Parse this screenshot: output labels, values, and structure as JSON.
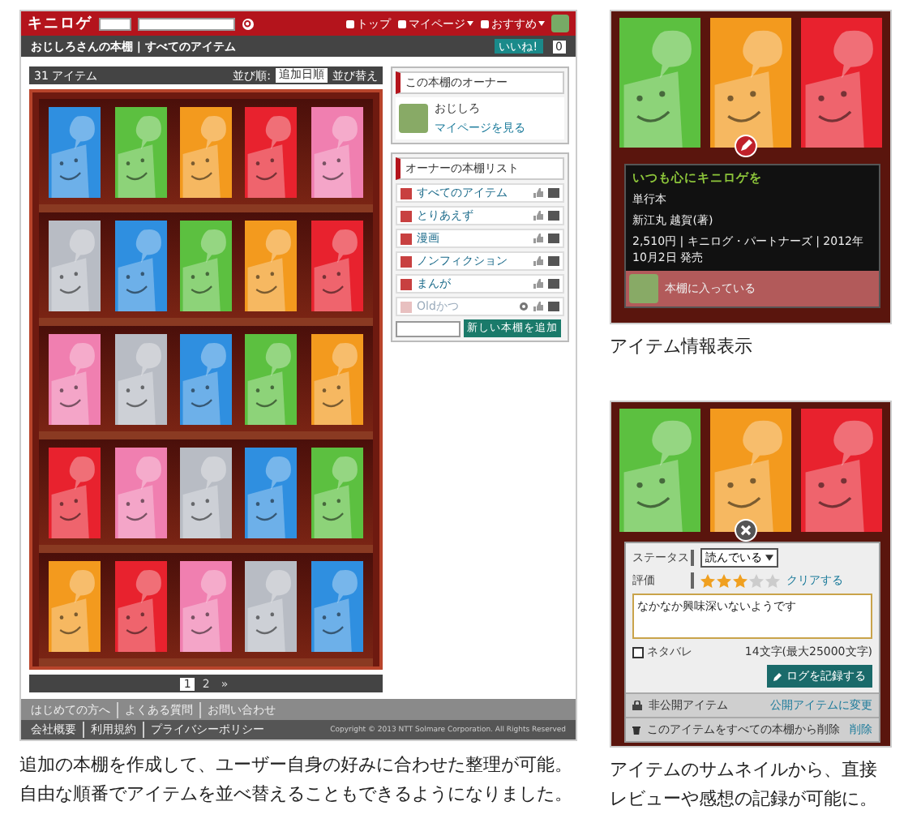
{
  "site": {
    "logo": "キニロゲ",
    "nav": [
      {
        "label": "トップ",
        "menu": false
      },
      {
        "label": "マイページ",
        "menu": true
      },
      {
        "label": "おすすめ",
        "menu": true
      }
    ]
  },
  "breadcrumb": {
    "text": "おじしろさんの本棚 | すべてのアイテム",
    "like": "いいね!",
    "like_count": "0"
  },
  "toolbar": {
    "count": "31 アイテム",
    "sort_label": "並び順:",
    "sort_value": "追加日順",
    "sort_button": "並び替え"
  },
  "shelves": [
    {
      "books": [
        {
          "color": "#2f8fe0"
        },
        {
          "color": "#5cc040"
        },
        {
          "color": "#f39a1e"
        },
        {
          "color": "#e8222e"
        },
        {
          "color": "#f07fb0"
        }
      ]
    },
    {
      "books": [
        {
          "color": "#b8bcc4"
        },
        {
          "color": "#2f8fe0"
        },
        {
          "color": "#5cc040"
        },
        {
          "color": "#f39a1e"
        },
        {
          "color": "#e8222e"
        }
      ]
    },
    {
      "books": [
        {
          "color": "#f07fb0"
        },
        {
          "color": "#b8bcc4"
        },
        {
          "color": "#2f8fe0"
        },
        {
          "color": "#5cc040"
        },
        {
          "color": "#f39a1e"
        }
      ]
    },
    {
      "books": [
        {
          "color": "#e8222e"
        },
        {
          "color": "#f07fb0"
        },
        {
          "color": "#b8bcc4"
        },
        {
          "color": "#2f8fe0"
        },
        {
          "color": "#5cc040"
        }
      ]
    },
    {
      "books": [
        {
          "color": "#f39a1e"
        },
        {
          "color": "#e8222e"
        },
        {
          "color": "#f07fb0"
        },
        {
          "color": "#b8bcc4"
        },
        {
          "color": "#2f8fe0"
        }
      ]
    }
  ],
  "pagination": {
    "pages": [
      {
        "label": "1",
        "selected": true
      },
      {
        "label": "2",
        "selected": false
      }
    ],
    "next": "»"
  },
  "owner": {
    "heading": "この本棚のオーナー",
    "name": "おじしろ",
    "link": "マイページを見る"
  },
  "shelf_list": {
    "heading": "オーナーの本棚リスト",
    "items": [
      {
        "label": "すべてのアイテム",
        "private": false
      },
      {
        "label": "とりあえず",
        "private": false
      },
      {
        "label": "漫画",
        "private": false
      },
      {
        "label": "ノンフィクション",
        "private": false
      },
      {
        "label": "まんが",
        "private": false
      },
      {
        "label": "Oldかつ",
        "private": true
      }
    ],
    "add_button": "新しい本棚を追加"
  },
  "footer": {
    "links": [
      "はじめての方へ",
      "よくある質問",
      "お問い合わせ"
    ],
    "legal": [
      "会社概要",
      "利用規約",
      "プライバシーポリシー"
    ],
    "copyright": "Copyright © 2013 NTT Solmare Corporation. All Rights Reserved"
  },
  "caption": "追加の本棚を作成して、ユーザー自身の好みに合わせた整理が可能。自由な順番でアイテムを並べ替えることもできるようになりました。",
  "item_info": {
    "books": [
      {
        "color": "#5cc040"
      },
      {
        "color": "#f39a1e"
      },
      {
        "color": "#e8222e"
      }
    ],
    "title": "いつも心にキニロゲを",
    "format": "単行本",
    "author": "新江丸 越賀(著)",
    "details": "2,510円 | キニログ・パートナーズ | 2012年10月2日 発売",
    "shelf_note": "本棚に入っている",
    "caption": "アイテム情報表示"
  },
  "log_form": {
    "books": [
      {
        "color": "#5cc040"
      },
      {
        "color": "#f39a1e"
      },
      {
        "color": "#e8222e"
      }
    ],
    "status_label": "ステータス",
    "status_value": "読んでいる",
    "rating_label": "評価",
    "stars": 3,
    "clear": "クリアする",
    "comment": "なかなか興味深いないようです",
    "spoiler": {
      "label": "ネタバレ",
      "checked": false
    },
    "char_count": "14文字(最大25000文字)",
    "submit": "ログを記録する",
    "private_label": "非公開アイテム",
    "public_link": "公開アイテムに変更",
    "delete_label": "このアイテムをすべての本棚から削除",
    "delete_link": "削除",
    "caption": "アイテムのサムネイルから、直接レビューや感想の記録が可能に。"
  }
}
